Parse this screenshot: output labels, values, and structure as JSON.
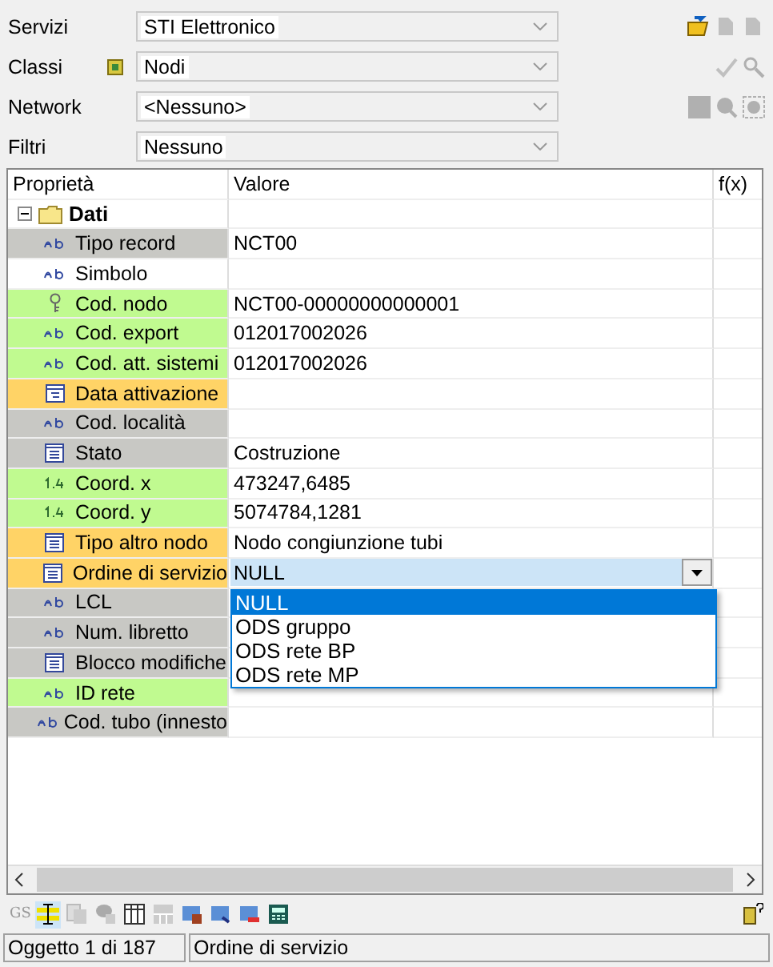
{
  "filters": [
    {
      "label": "Servizi",
      "value": "STI Elettronico",
      "has_icon": false
    },
    {
      "label": "Classi",
      "value": "Nodi",
      "has_icon": true
    },
    {
      "label": "Network",
      "value": "<Nessuno>",
      "has_icon": false
    },
    {
      "label": "Filtri",
      "value": "Nessuno",
      "has_icon": false
    }
  ],
  "grid": {
    "columns": [
      "Proprietà",
      "Valore",
      "f(x)"
    ],
    "group": {
      "label": "Dati",
      "expanded": true
    },
    "rows": [
      {
        "name": "Tipo record",
        "value": "NCT00",
        "kind": "text",
        "color": "#c8c8c4"
      },
      {
        "name": "Simbolo",
        "value": "",
        "kind": "text",
        "color": "#ffffff"
      },
      {
        "name": "Cod. nodo",
        "value": "NCT00-00000000000001",
        "kind": "key",
        "color": "#c0fa90"
      },
      {
        "name": "Cod. export",
        "value": "012017002026",
        "kind": "text",
        "color": "#c0fa90"
      },
      {
        "name": "Cod. att. sistemi",
        "value": "012017002026",
        "kind": "text",
        "color": "#c0fa90"
      },
      {
        "name": "Data attivazione",
        "value": "",
        "kind": "date",
        "color": "#ffd366"
      },
      {
        "name": "Cod. località",
        "value": "",
        "kind": "text",
        "color": "#c8c8c4"
      },
      {
        "name": "Stato",
        "value": "Costruzione",
        "kind": "list",
        "color": "#c8c8c4"
      },
      {
        "name": "Coord. x",
        "value": "473247,6485",
        "kind": "number",
        "color": "#c0fa90"
      },
      {
        "name": "Coord. y",
        "value": "5074784,1281",
        "kind": "number",
        "color": "#c0fa90"
      },
      {
        "name": "Tipo altro nodo",
        "value": "Nodo congiunzione tubi",
        "kind": "list",
        "color": "#ffd366"
      },
      {
        "name": "Ordine di servizio",
        "value": "NULL",
        "kind": "list",
        "color": "#ffd366",
        "editing": true,
        "options": [
          {
            "label": "NULL",
            "selected": true
          },
          {
            "label": "ODS gruppo",
            "selected": false
          },
          {
            "label": "ODS rete BP",
            "selected": false
          },
          {
            "label": "ODS rete MP",
            "selected": false
          }
        ]
      },
      {
        "name": "LCL",
        "value": "",
        "kind": "text",
        "color": "#c8c8c4"
      },
      {
        "name": "Num. libretto",
        "value": "",
        "kind": "text",
        "color": "#c8c8c4"
      },
      {
        "name": "Blocco modifiche",
        "value": "",
        "kind": "list",
        "color": "#c8c8c4"
      },
      {
        "name": "ID rete",
        "value": "",
        "kind": "text",
        "color": "#c0fa90"
      },
      {
        "name": "Cod. tubo (innesto",
        "value": "",
        "kind": "text",
        "color": "#c8c8c4"
      }
    ]
  },
  "toolbar": {
    "gs_label": "GS"
  },
  "status_bar": [
    "Oggetto 1 di 187",
    "Ordine di servizio"
  ]
}
